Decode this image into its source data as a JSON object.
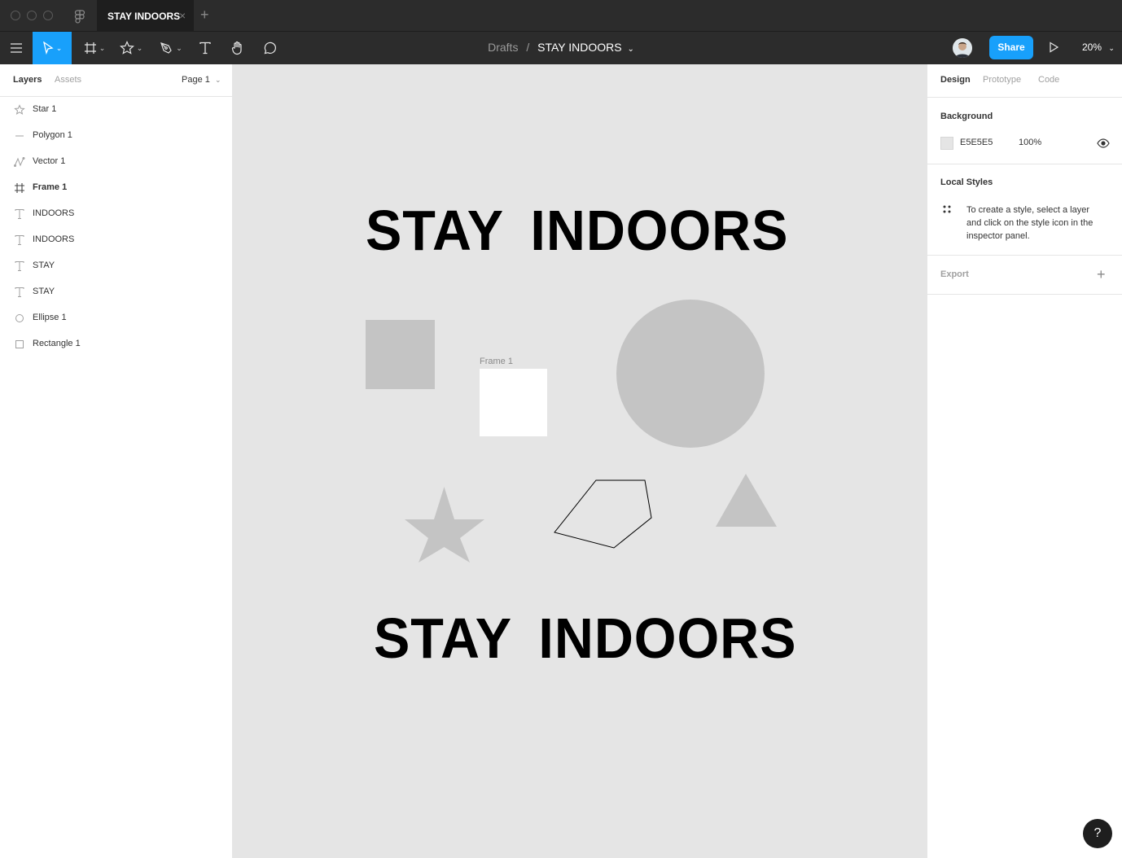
{
  "titlebar": {
    "tab_title": "STAY INDOORS",
    "close_glyph": "×",
    "new_tab_glyph": "+"
  },
  "toolbar": {
    "menu_icon": "hamburger-icon",
    "tools": [
      {
        "name": "move-tool",
        "icon": "pointer-icon",
        "active": true
      },
      {
        "name": "frame-tool",
        "icon": "frame-hash-icon"
      },
      {
        "name": "shape-tool",
        "icon": "star-icon"
      },
      {
        "name": "pen-tool",
        "icon": "pen-icon"
      },
      {
        "name": "text-tool",
        "icon": "text-icon"
      },
      {
        "name": "hand-tool",
        "icon": "hand-icon"
      },
      {
        "name": "comment-tool",
        "icon": "comment-icon"
      }
    ],
    "breadcrumb": {
      "parent": "Drafts",
      "separator": "/",
      "file": "STAY INDOORS"
    },
    "share_label": "Share",
    "zoom": "20%",
    "accent": "#18A0FB"
  },
  "left_panel": {
    "tabs": {
      "layers": "Layers",
      "assets": "Assets"
    },
    "page_selector": "Page 1",
    "layers": [
      {
        "label": "Star 1",
        "icon": "star-icon"
      },
      {
        "label": "Polygon 1",
        "icon": "polygon-icon"
      },
      {
        "label": "Vector 1",
        "icon": "vector-icon"
      },
      {
        "label": "Frame 1",
        "icon": "frame-hash-icon",
        "bold": true
      },
      {
        "label": "INDOORS",
        "icon": "text-icon"
      },
      {
        "label": "INDOORS",
        "icon": "text-icon"
      },
      {
        "label": "STAY",
        "icon": "text-icon"
      },
      {
        "label": "STAY",
        "icon": "text-icon"
      },
      {
        "label": "Ellipse 1",
        "icon": "ellipse-icon"
      },
      {
        "label": "Rectangle 1",
        "icon": "rectangle-icon"
      }
    ]
  },
  "canvas": {
    "background": "#E5E5E5",
    "top_text": {
      "stay": "STAY",
      "indoors": "INDOORS"
    },
    "bottom_text": {
      "stay": "STAY",
      "indoors": "INDOORS"
    },
    "frame_label": "Frame 1",
    "shape_fill": "#C4C4C4"
  },
  "right_panel": {
    "tabs": {
      "design": "Design",
      "prototype": "Prototype",
      "code": "Code"
    },
    "background": {
      "title": "Background",
      "hex": "E5E5E5",
      "opacity": "100%"
    },
    "local_styles": {
      "title": "Local Styles",
      "line1": "To create a style, select a layer",
      "line2": "and click on the style icon in the",
      "line3": "inspector panel."
    },
    "export": {
      "title": "Export",
      "add_glyph": "+"
    }
  },
  "help": {
    "glyph": "?"
  }
}
